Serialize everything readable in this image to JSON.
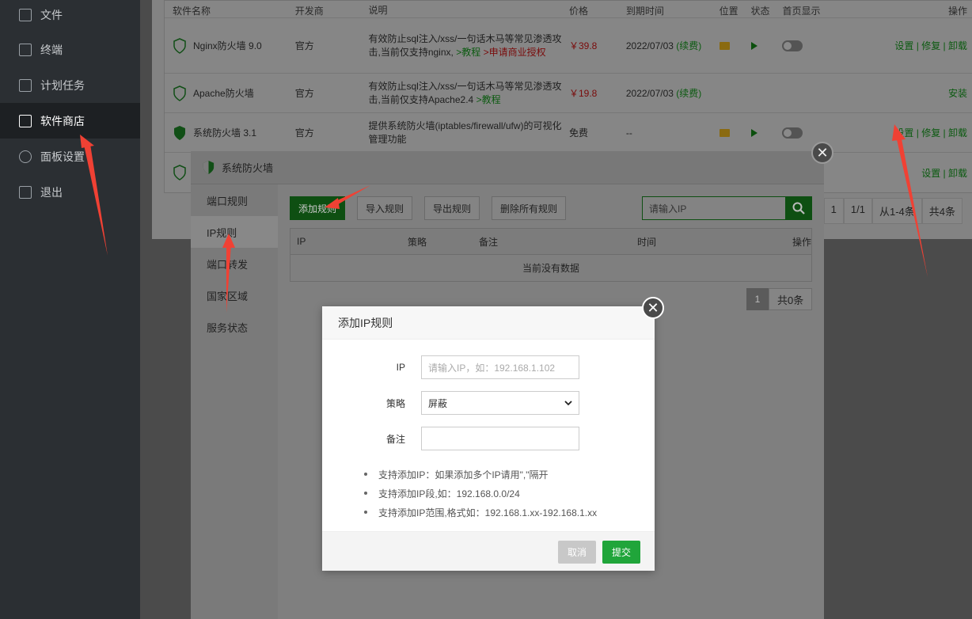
{
  "sidebar": {
    "items": [
      {
        "label": "文件"
      },
      {
        "label": "终端"
      },
      {
        "label": "计划任务"
      },
      {
        "label": "软件商店"
      },
      {
        "label": "面板设置"
      },
      {
        "label": "退出"
      }
    ]
  },
  "store_table": {
    "headers": [
      "软件名称",
      "开发商",
      "说明",
      "价格",
      "到期时间",
      "位置",
      "状态",
      "首页显示",
      "操作"
    ],
    "rows": [
      {
        "name": "Nginx防火墙 9.0",
        "dev": "官方",
        "desc": "有效防止sql注入/xss/一句话木马等常见渗透攻击,当前仅支持nginx,",
        "desc_link1": ">教程",
        "desc_link2": ">申请商业授权",
        "price": "￥39.8",
        "expire": "2022/07/03",
        "renew": "(续费)",
        "ops": "设置 | 修复 | 卸载"
      },
      {
        "name": "Apache防火墙",
        "dev": "官方",
        "desc": "有效防止sql注入/xss/一句话木马等常见渗透攻击,当前仅支持Apache2.4",
        "desc_link1": ">教程",
        "price": "￥19.8",
        "expire": "2022/07/03",
        "renew": "(续费)",
        "ops": "安装"
      },
      {
        "name": "系统防火墙 3.1",
        "dev": "官方",
        "desc": "提供系统防火墙(iptables/firewall/ufw)的可视化管理功能",
        "price": "免费",
        "expire": "--",
        "ops": "设置 | 修复 | 卸载"
      },
      {
        "ops": "设置 | 卸载"
      }
    ],
    "pager": [
      "1",
      "1/1",
      "从1-4条",
      "共4条"
    ]
  },
  "firewall_modal": {
    "title": "系统防火墙",
    "tabs": [
      "端口规则",
      "IP规则",
      "端口转发",
      "国家区域",
      "服务状态"
    ],
    "buttons": [
      "添加规则",
      "导入规则",
      "导出规则",
      "删除所有规则"
    ],
    "search_placeholder": "请输入IP",
    "ip_table": {
      "headers": [
        "IP",
        "策略",
        "备注",
        "时间",
        "操作"
      ],
      "empty": "当前没有数据"
    },
    "pager": {
      "page": "1",
      "total": "共0条"
    }
  },
  "add_ip_modal": {
    "title": "添加IP规则",
    "ip_label": "IP",
    "ip_placeholder": "请输入IP，如：192.168.1.102",
    "policy_label": "策略",
    "policy_value": "屏蔽",
    "note_label": "备注",
    "note_value": "",
    "notes": [
      "支持添加IP：如果添加多个IP请用\",\"隔开",
      "支持添加IP段,如：192.168.0.0/24",
      "支持添加IP范围,格式如：192.168.1.xx-192.168.1.xx"
    ],
    "cancel_label": "取消",
    "submit_label": "提交"
  },
  "colors": {
    "sidebar_bg": "#2b2f33",
    "accent_green": "#20a53a",
    "arrow_red": "#f04134"
  }
}
